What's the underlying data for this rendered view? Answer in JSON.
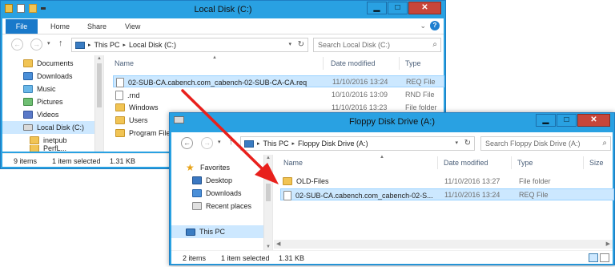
{
  "colors": {
    "titlebar": "#29a1e2",
    "accent": "#1979ca",
    "selection": "#cce8ff",
    "arrow": "#e8201c"
  },
  "icons": {
    "folder": "folder-icon",
    "document": "document-icon",
    "drive": "drive-icon",
    "favorites": "star-icon",
    "pc": "computer-icon"
  },
  "w1": {
    "title": "Local Disk (C:)",
    "ribbon": {
      "file": "File",
      "home": "Home",
      "share": "Share",
      "view": "View",
      "chevron": "⌄",
      "help": "?"
    },
    "nav_back": "←",
    "nav_fwd": "→",
    "nav_drop": "▾",
    "nav_up": "↑",
    "breadcrumb": [
      "This PC",
      "Local Disk (C:)"
    ],
    "breadcrumb_sep": "▸",
    "search_placeholder": "Search Local Disk (C:)",
    "columns": {
      "name": "Name",
      "date": "Date modified",
      "type": "Type"
    },
    "nav_items": [
      {
        "label": "Documents"
      },
      {
        "label": "Downloads"
      },
      {
        "label": "Music"
      },
      {
        "label": "Pictures"
      },
      {
        "label": "Videos"
      },
      {
        "label": "Local Disk (C:)"
      },
      {
        "label": "inetpub"
      },
      {
        "label": "PerfL..."
      }
    ],
    "files": [
      {
        "name": "02-SUB-CA.cabench.com_cabench-02-SUB-CA-CA.req",
        "date": "11/10/2016 13:24",
        "type": "REQ File"
      },
      {
        "name": ".rnd",
        "date": "10/10/2016 13:09",
        "type": "RND File"
      },
      {
        "name": "Windows",
        "date": "11/10/2016 13:23",
        "type": "File folder"
      },
      {
        "name": "Users",
        "date": "",
        "type": ""
      },
      {
        "name": "Program Files",
        "date": "",
        "type": ""
      }
    ],
    "status": {
      "count": "9 items",
      "selected": "1 item selected",
      "size": "1.31 KB"
    }
  },
  "w2": {
    "title": "Floppy Disk Drive (A:)",
    "nav_back": "←",
    "nav_fwd": "→",
    "nav_drop": "▾",
    "nav_up": "↑",
    "breadcrumb": [
      "This PC",
      "Floppy Disk Drive (A:)"
    ],
    "breadcrumb_sep": "▸",
    "search_placeholder": "Search Floppy Disk Drive (A:)",
    "columns": {
      "name": "Name",
      "date": "Date modified",
      "type": "Type",
      "size": "Size"
    },
    "nav_items": [
      {
        "label": "Favorites"
      },
      {
        "label": "Desktop"
      },
      {
        "label": "Downloads"
      },
      {
        "label": "Recent places"
      },
      {
        "label": "This PC"
      }
    ],
    "files": [
      {
        "name": "OLD-Files",
        "date": "11/10/2016 13:27",
        "type": "File folder"
      },
      {
        "name": "02-SUB-CA.cabench.com_cabench-02-S...",
        "date": "11/10/2016 13:24",
        "type": "REQ File"
      }
    ],
    "status": {
      "count": "2 items",
      "selected": "1 item selected",
      "size": "1.31 KB"
    }
  },
  "window_controls": {
    "minimize": "▁",
    "maximize": "□",
    "close": "✕"
  }
}
